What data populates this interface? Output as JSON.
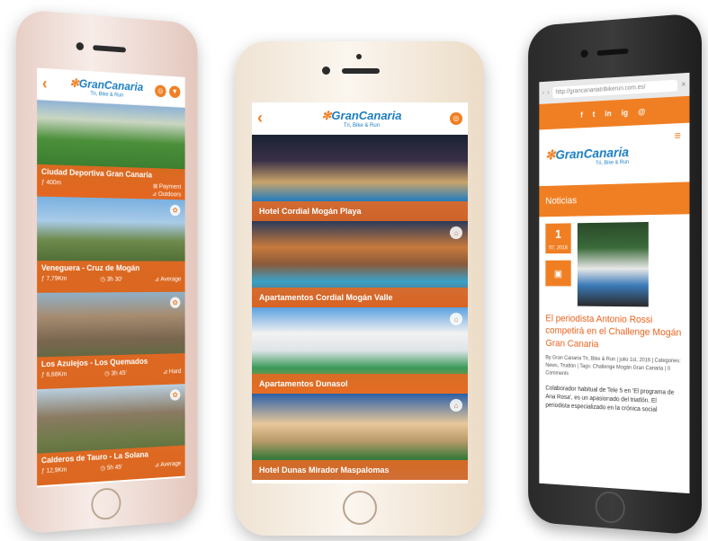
{
  "app": {
    "logo_text": "GranCanaria",
    "logo_sub": "Tri, Bike & Run"
  },
  "routes": [
    {
      "name": "Ciudad Deportiva Gran Canaria",
      "distance": "400m",
      "price": "Payment",
      "level": "Outdoors"
    },
    {
      "name": "Veneguera - Cruz de Mogán",
      "distance": "7,79Km",
      "time": "3h 30'",
      "level": "Average"
    },
    {
      "name": "Los Azulejos - Los Quemados",
      "distance": "6,68Km",
      "time": "3h 45'",
      "level": "Hard"
    },
    {
      "name": "Calderos de Tauro - La Solana",
      "distance": "12,9Km",
      "time": "5h 45'",
      "level": "Average"
    }
  ],
  "hotels": [
    {
      "name": "Hotel Cordial Mogán Playa"
    },
    {
      "name": "Apartamentos Cordial Mogán Valle"
    },
    {
      "name": "Apartamentos Dunasol"
    },
    {
      "name": "Hotel Dunas Mirador Maspalomas"
    }
  ],
  "browser": {
    "url": "http://grancanariatribikerun.com.es/"
  },
  "website": {
    "social": [
      "f",
      "t",
      "in",
      "ig",
      "@"
    ],
    "section": "Noticias",
    "post": {
      "day": "1",
      "month": "07, 2016",
      "title": "El periodista Antonio Rossi competirá en el Challenge Mogán Gran Canaria",
      "meta": "By Gran Canaria Tri, Bike & Run | julio 1st, 2016 | Categories: News, Triatlón | Tags: Challenge Mogán Gran Canaria | 0 Comments",
      "body": "Colaborador habitual de Tele 5 en 'El programa de Ana Rosa', es un apasionado del triatlón. El periodista especializado en la crónica social"
    }
  },
  "colors": {
    "accent": "#f07f23",
    "brand_blue": "#1b7ec2"
  }
}
